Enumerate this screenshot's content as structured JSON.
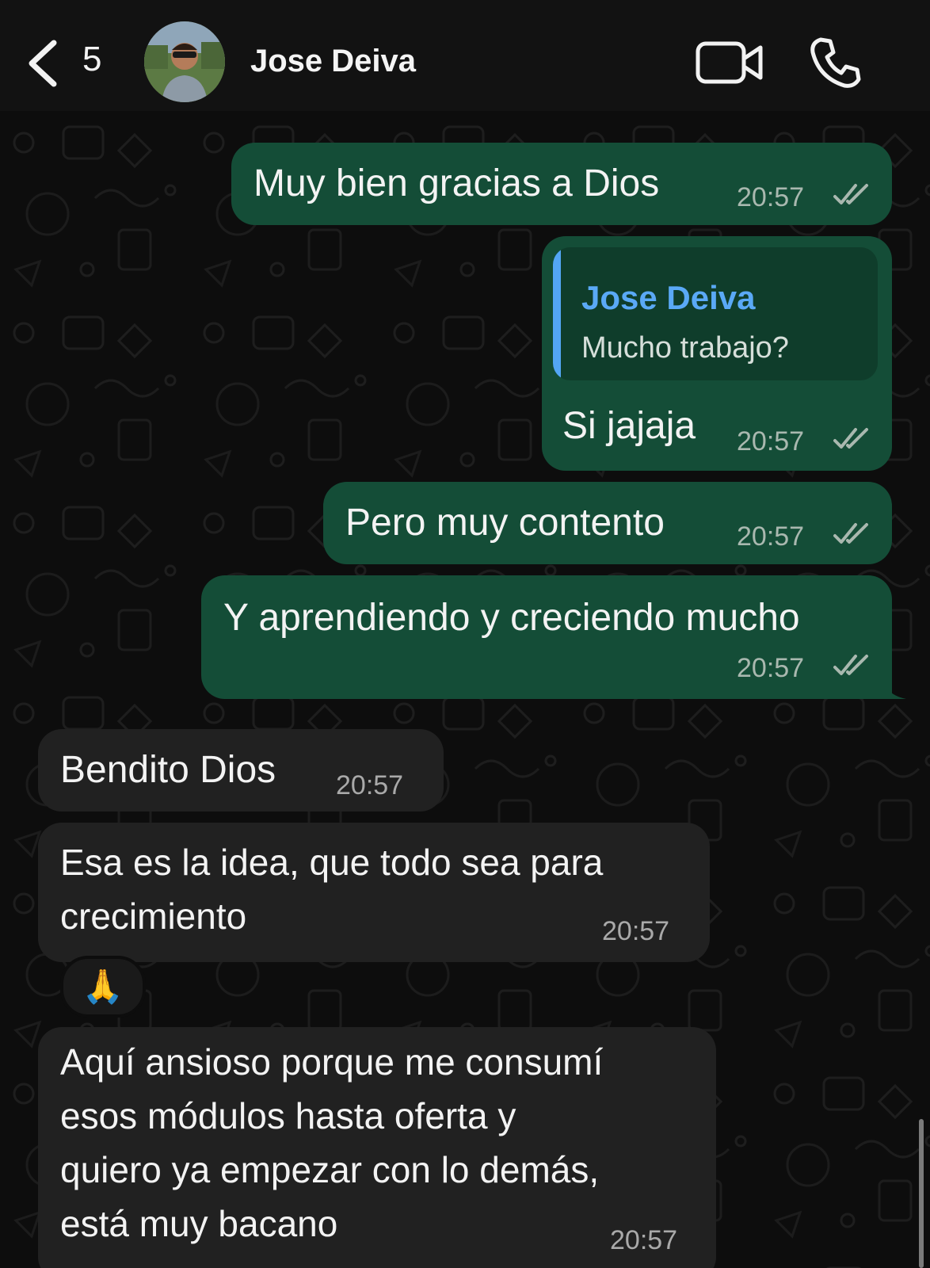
{
  "header": {
    "back_count": "5",
    "contact_name": "Jose Deiva"
  },
  "messages": [
    {
      "direction": "out",
      "text": "Muy bien gracias a Dios",
      "time": "20:57"
    },
    {
      "direction": "out",
      "quote": {
        "author": "Jose Deiva",
        "text": "Mucho trabajo?"
      },
      "text": "Si jajaja",
      "time": "20:57"
    },
    {
      "direction": "out",
      "text": "Pero muy contento",
      "time": "20:57"
    },
    {
      "direction": "out",
      "text": "Y aprendiendo y creciendo mucho",
      "time": "20:57"
    },
    {
      "direction": "in",
      "text": "Bendito Dios",
      "time": "20:57"
    },
    {
      "direction": "in",
      "lines": [
        "Esa es la idea, que todo sea para",
        "crecimiento"
      ],
      "time": "20:57",
      "reaction": "🙏"
    },
    {
      "direction": "in",
      "lines": [
        "Aquí ansioso porque me consumí",
        "esos módulos hasta oferta y",
        "quiero ya empezar con lo demás,",
        "está muy bacano"
      ],
      "time": "20:57"
    }
  ],
  "colors": {
    "outgoing_bubble": "#144d37",
    "incoming_bubble": "#212121",
    "quote_accent": "#53a6f5"
  },
  "icons": [
    "chevron-left-icon",
    "video-camera-icon",
    "phone-icon",
    "double-check-icon"
  ]
}
